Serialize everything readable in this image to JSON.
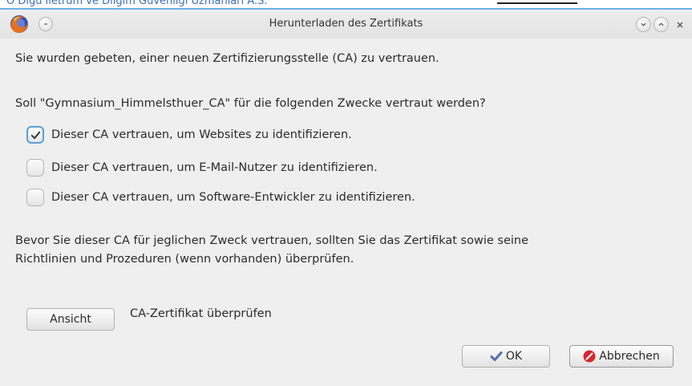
{
  "window": {
    "title": "Herunterladen des Zertifikats",
    "background_text": "O Dlgu lletrum ve Dilgim Güvenliği Uzmanları A.S."
  },
  "message": {
    "intro": "Sie wurden gebeten, einer neuen Zertifizierungsstelle (CA) zu vertrauen.",
    "question": "Soll \"Gymnasium_Himmelsthuer_CA\" für die folgenden Zwecke vertraut werden?",
    "warning_line1": "Bevor Sie dieser CA für jeglichen Zweck vertrauen, sollten Sie das Zertifikat sowie seine",
    "warning_line2": "Richtlinien und Prozeduren (wenn vorhanden) überprüfen."
  },
  "options": [
    {
      "label": "Dieser CA vertrauen, um Websites zu identifizieren.",
      "checked": true
    },
    {
      "label": "Dieser CA vertrauen, um E-Mail-Nutzer zu identifizieren.",
      "checked": false
    },
    {
      "label": "Dieser CA vertrauen, um Software-Entwickler zu identifizieren.",
      "checked": false
    }
  ],
  "view": {
    "button_label": "Ansicht",
    "description": "CA-Zertifikat überprüfen"
  },
  "buttons": {
    "ok_label": "OK",
    "cancel_label": "Abbrechen"
  },
  "colors": {
    "accent": "#5a9fd4",
    "titlebar_border": "#6db1e8",
    "cancel_icon": "#d8262f",
    "ok_icon": "#4f6fb0"
  },
  "icons": {
    "app": "firefox-icon",
    "menu": "window-menu-icon",
    "minimize": "chevron-down-icon",
    "maximize": "chevron-up-icon",
    "close": "close-icon",
    "ok": "checkmark-icon",
    "cancel": "stop-icon"
  }
}
